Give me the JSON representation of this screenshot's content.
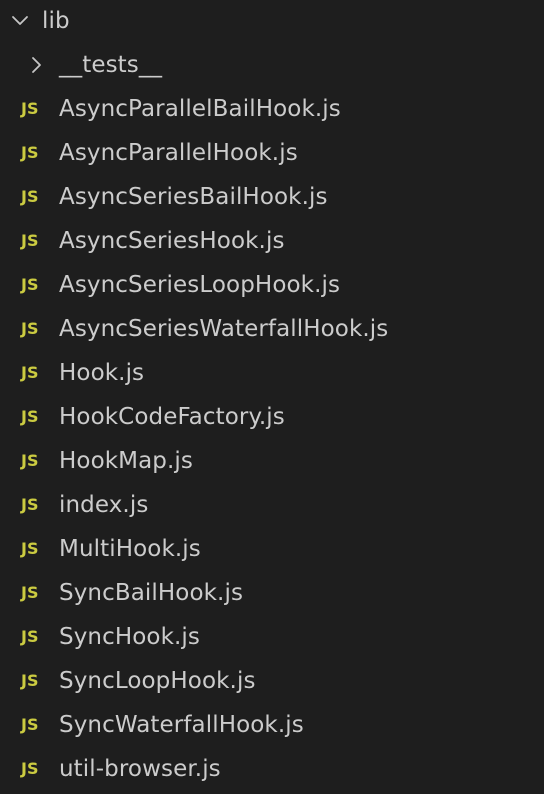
{
  "tree": {
    "root": {
      "label": "lib",
      "expanded": true,
      "chevron_icon": "chevron-down-icon"
    },
    "tests_folder": {
      "label": "__tests__",
      "expanded": false,
      "chevron_icon": "chevron-right-icon"
    },
    "file_icon_text": "JS",
    "colors": {
      "background": "#1e1e1e",
      "text": "#cccccc",
      "js_icon": "#cbcb41",
      "chevron": "#c5c5c5"
    },
    "files": [
      "AsyncParallelBailHook.js",
      "AsyncParallelHook.js",
      "AsyncSeriesBailHook.js",
      "AsyncSeriesHook.js",
      "AsyncSeriesLoopHook.js",
      "AsyncSeriesWaterfallHook.js",
      "Hook.js",
      "HookCodeFactory.js",
      "HookMap.js",
      "index.js",
      "MultiHook.js",
      "SyncBailHook.js",
      "SyncHook.js",
      "SyncLoopHook.js",
      "SyncWaterfallHook.js",
      "util-browser.js"
    ]
  }
}
